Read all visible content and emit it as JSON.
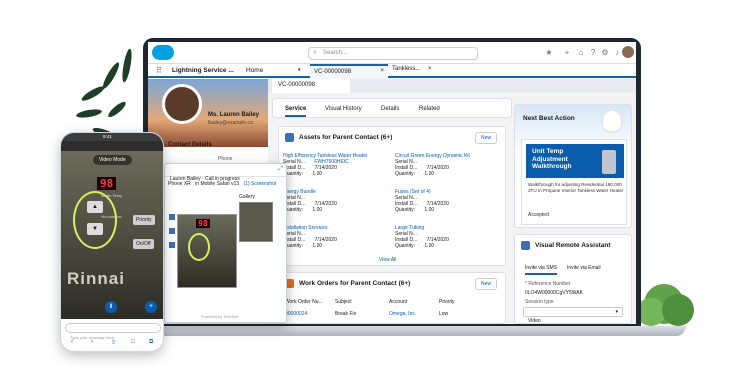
{
  "app": {
    "name": "Lightning Service ...",
    "search_placeholder": "Search..."
  },
  "nav": {
    "home": "Home",
    "case_tab": "VC-00000098",
    "case_tab_sub": "Tankless..."
  },
  "subtab": {
    "case": "VC-00000098"
  },
  "contact": {
    "name": "Ms. Lauren Bailey",
    "email": "lbailey@example.co",
    "details_title": "Contact Details",
    "phone_label": "Phone"
  },
  "tabs": [
    "Service",
    "Visual History",
    "Details",
    "Related"
  ],
  "assets": {
    "title": "Assets for Parent Contact (6+)",
    "new_label": "New",
    "view_all": "View All",
    "items": [
      {
        "name": "High Efficiency Tankless Water Heater",
        "serial_label": "Serial N...",
        "serial": "FWH7500HEIC",
        "date_label": "Install D...",
        "date": "7/14/2020",
        "qty_label": "Quantity:",
        "qty": "1.00"
      },
      {
        "name": "Circuit Green Energy Dynamic Kit",
        "serial_label": "Serial N...",
        "serial": "",
        "date_label": "Install D...",
        "date": "7/14/2020",
        "qty_label": "Quantity:",
        "qty": "1.00"
      },
      {
        "name": "Energy Bundle",
        "serial_label": "Serial N...",
        "serial": "",
        "date_label": "Install D...",
        "date": "7/14/2020",
        "qty_label": "Quantity:",
        "qty": "1.00"
      },
      {
        "name": "Fuses (Set of 4)",
        "serial_label": "Serial N...",
        "serial": "",
        "date_label": "Install D...",
        "date": "7/14/2020",
        "qty_label": "Quantity:",
        "qty": "1.00"
      },
      {
        "name": "Installation Services",
        "serial_label": "Serial N...",
        "serial": "",
        "date_label": "Install D...",
        "date": "7/14/2020",
        "qty_label": "Quantity:",
        "qty": "1.00"
      },
      {
        "name": "Large Tubing",
        "serial_label": "Serial N...",
        "serial": "",
        "date_label": "Install D...",
        "date": "7/14/2020",
        "qty_label": "Quantity:",
        "qty": "1.00"
      }
    ]
  },
  "work_orders": {
    "title": "Work Orders for Parent Contact (6+)",
    "new_label": "New",
    "columns": [
      "Work Order Nu...",
      "Subject",
      "Account",
      "Priority"
    ],
    "row": [
      "00000024",
      "Break Fix",
      "Omega, Inc.",
      "Low"
    ]
  },
  "nba": {
    "title": "Next Best Action",
    "card_title": "Unit Temp Adjustment Walkthrough",
    "card_desc": "Walkthrough for adjusting Residential 180,000 3TU In Propane Interior Tankless Water Heater",
    "accepted": "Accepted"
  },
  "vra": {
    "title": "Visual Remote Assistant",
    "tab_sms": "Invite via SMS",
    "tab_email": "Invite via Email",
    "ref_label": "* Reference Number",
    "ref_value": "0LO4W00000CgVY5WAK",
    "session_label": "Session type",
    "session_value": "Video"
  },
  "popup": {
    "header": "Lauren Bailey · Call in progress",
    "device_label": "Phone XR",
    "browser": "in Mobile Safari v13",
    "screenshots": "(1) Screenshot",
    "gallery": "Gallery",
    "temp": "98",
    "powered": "Powered by TechSee"
  },
  "phone": {
    "time": "9:41",
    "url": "d.demo.techsee.me",
    "video_mode": "Video Mode",
    "temp": "98",
    "temp_caption": "Water Temp",
    "btn_priority": "Priority",
    "btn_onoff": "On/Off",
    "hot_water": "Hot water Inc",
    "message_placeholder": "Type your message here",
    "brand": "Rinnai"
  }
}
